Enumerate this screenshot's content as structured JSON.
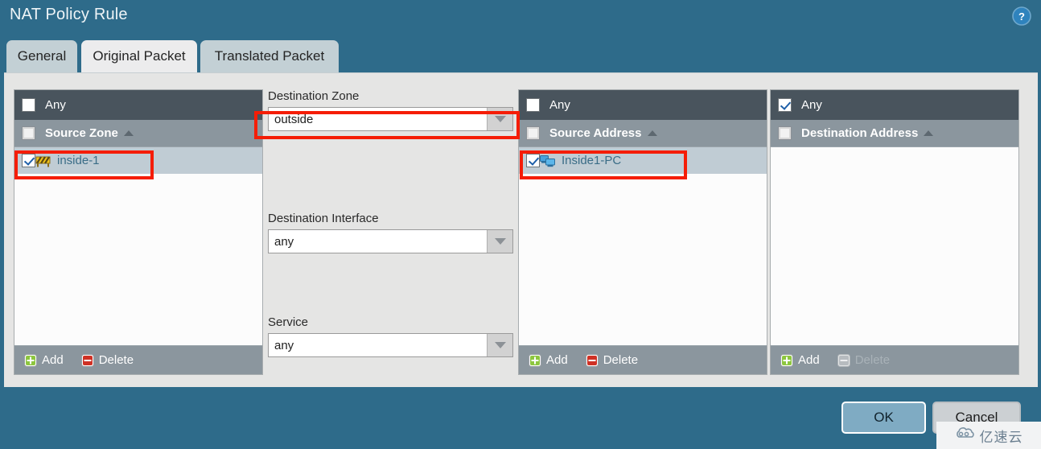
{
  "window": {
    "title": "NAT Policy Rule",
    "help_icon": "help-circle-icon",
    "accent_color": "#2e6b8a",
    "content_bg": "#e5e5e4"
  },
  "tabs": [
    {
      "label": "General",
      "active": false
    },
    {
      "label": "Original Packet",
      "active": true
    },
    {
      "label": "Translated Packet",
      "active": false
    }
  ],
  "panels": [
    {
      "any_label": "Any",
      "any_checked": false,
      "column_header": "Source Zone",
      "sort_direction": "ascending",
      "header_checked": false,
      "rows": [
        {
          "label": "inside-1",
          "checked": true,
          "icon": "zone-barrier-icon",
          "selected": true
        }
      ],
      "add_label": "Add",
      "delete_label": "Delete",
      "delete_enabled": true
    },
    {
      "any_label": "Any",
      "any_checked": false,
      "column_header": "Source Address",
      "sort_direction": "ascending",
      "header_checked": false,
      "rows": [
        {
          "label": "Inside1-PC",
          "checked": true,
          "icon": "host-computer-icon",
          "selected": true
        }
      ],
      "add_label": "Add",
      "delete_label": "Delete",
      "delete_enabled": true
    },
    {
      "any_label": "Any",
      "any_checked": true,
      "column_header": "Destination Address",
      "sort_direction": "ascending",
      "header_checked": false,
      "rows": [],
      "add_label": "Add",
      "delete_label": "Delete",
      "delete_enabled": false
    }
  ],
  "form": {
    "destination_zone": {
      "label": "Destination Zone",
      "value": "outside",
      "arrow_icon": "chevron-down-icon"
    },
    "destination_interface": {
      "label": "Destination Interface",
      "value": "any",
      "arrow_icon": "chevron-down-icon"
    },
    "service": {
      "label": "Service",
      "value": "any",
      "arrow_icon": "chevron-down-icon"
    }
  },
  "footer": {
    "ok_label": "OK",
    "cancel_label": "Cancel"
  },
  "annotations": {
    "highlight_color": "#f51d06",
    "boxes": [
      "destination-zone-combo",
      "source-zone-row",
      "source-address-row"
    ]
  },
  "watermark": {
    "text": "亿速云",
    "logo_icon": "cloud-logo-icon"
  }
}
